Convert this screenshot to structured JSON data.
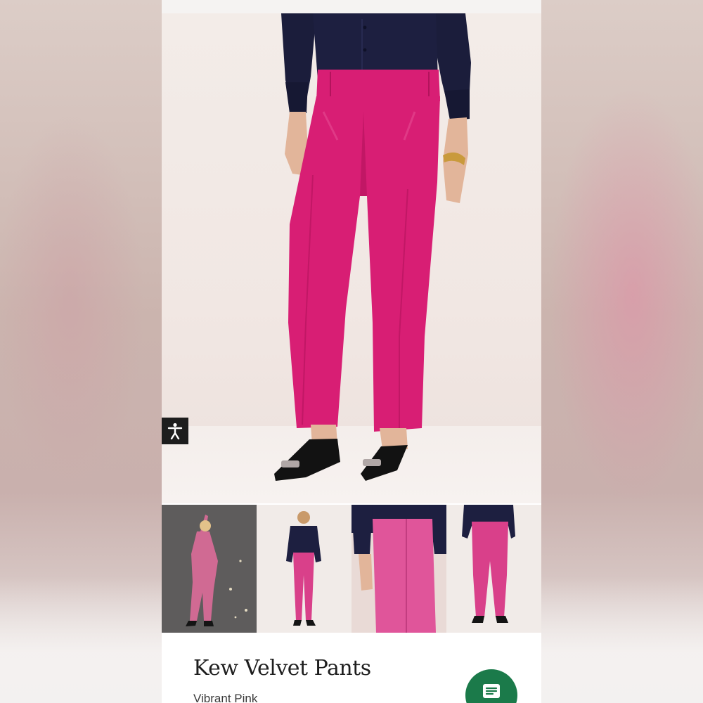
{
  "product": {
    "title": "Kew Velvet Pants",
    "color_name": "Vibrant Pink"
  },
  "gallery": {
    "main_image": "model-front-pink-velvet-pants",
    "thumbnails": [
      "model-full-suit-night",
      "model-full-front",
      "closeup-waist-front",
      "model-back-view"
    ]
  },
  "icons": {
    "accessibility": "accessibility-icon",
    "chat": "chat-icon"
  },
  "colors": {
    "accent_pink": "#d81e74",
    "chat_green": "#1b7a4a",
    "top_navy": "#1b1d3b"
  }
}
